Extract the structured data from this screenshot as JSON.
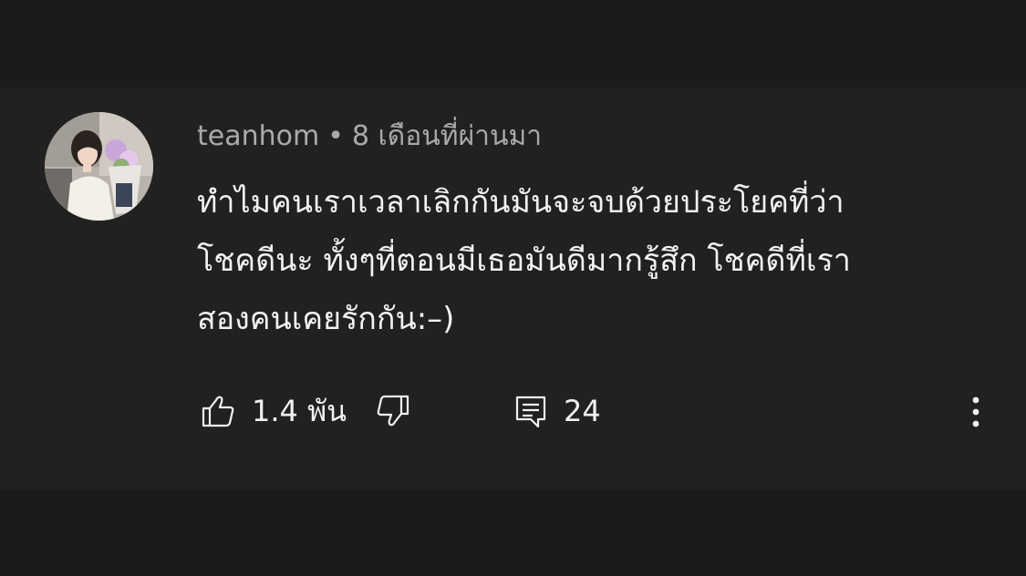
{
  "comment": {
    "author": "teanhom",
    "separator": "•",
    "timestamp": "8 เดือนที่ผ่านมา",
    "text_lines": [
      "ทำไมคนเราเวลาเลิกกันมันจะจบด้วยประโยคที่ว่า",
      "โชคดีนะ ทั้งๆที่ตอนมีเธอมันดีมากรู้สึก โชคดีที่เรา",
      "สองคนเคยรักกัน:–)"
    ],
    "avatar_icon": "user-avatar-photo"
  },
  "actions": {
    "like_icon": "thumbs-up-icon",
    "like_count": "1.4 พัน",
    "dislike_icon": "thumbs-down-icon",
    "reply_icon": "comment-icon",
    "reply_count": "24",
    "more_icon": "more-vertical-icon"
  },
  "colors": {
    "page_background": "#161616",
    "card_background": "#212121",
    "primary_text": "#f1f1f1",
    "secondary_text": "#aaaaaa"
  }
}
